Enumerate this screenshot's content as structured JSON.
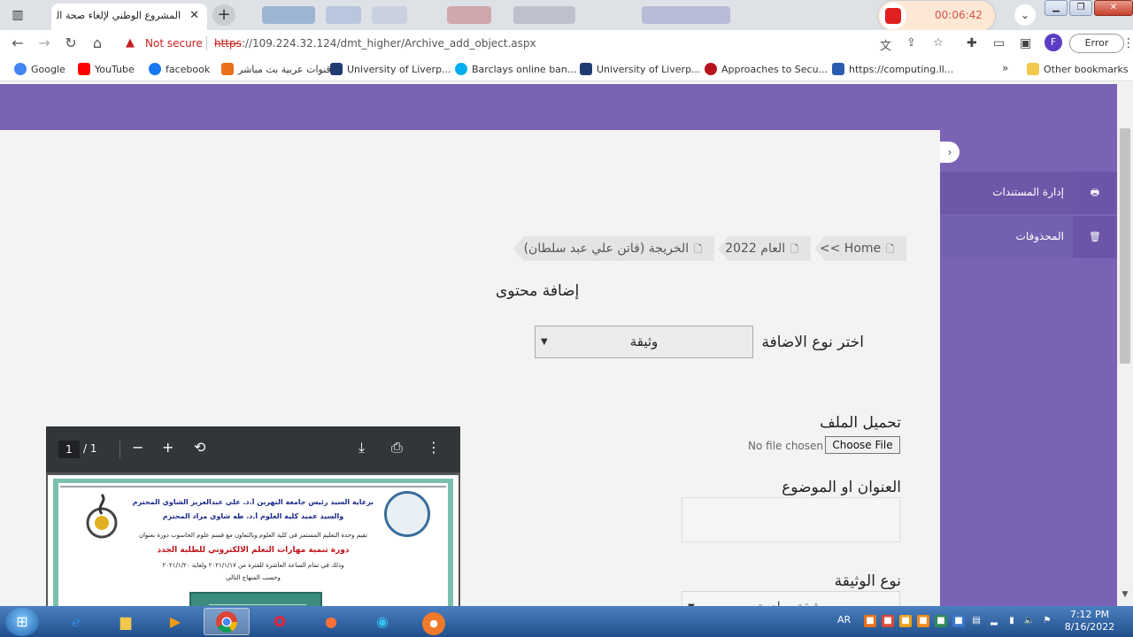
{
  "browser": {
    "tab_title": "المشروع الوطني لإلغاء صحة الصدور",
    "new_tab_label": "+",
    "recording_time": "00:06:42",
    "not_secure": "Not secure",
    "url_scheme": "https",
    "url_rest": "://109.224.32.124/dmt_higher/Archive_add_object.aspx",
    "profile_initial": "F",
    "error_label": "Error",
    "bookmarks": [
      {
        "label": "Google",
        "color": "#4285f4"
      },
      {
        "label": "YouTube",
        "color": "#ff0000"
      },
      {
        "label": "facebook",
        "color": "#1877f2"
      },
      {
        "label": "قنوات عربية بث مباشر",
        "color": "#e8711a"
      },
      {
        "label": "University of Liverp...",
        "color": "#1f3b70"
      },
      {
        "label": "Barclays online ban...",
        "color": "#00aeef"
      },
      {
        "label": "University of Liverp...",
        "color": "#1f3b70"
      },
      {
        "label": "Approaches to Secu...",
        "color": "#b5121b"
      },
      {
        "label": "https://computing.ll...",
        "color": "#2a5db0"
      }
    ],
    "other_bookmarks": "Other bookmarks"
  },
  "sidebar": {
    "items": [
      {
        "label": "إدارة المستندات",
        "icon": "print-icon"
      },
      {
        "label": "المحذوفات",
        "icon": "trash-icon"
      }
    ]
  },
  "breadcrumbs": [
    {
      "label": "Home >>"
    },
    {
      "label": "العام 2022"
    },
    {
      "label": "الخريجة (فاتن علي عبد سلطان)"
    }
  ],
  "form": {
    "title": "إضافة محتوى",
    "add_type_label": "اختر نوع الاضافة",
    "add_type_value": "وثيقة",
    "upload_label": "تحميل الملف",
    "no_file": "No file chosen",
    "choose_file": "Choose File",
    "subject_label": "العنوان او الموضوع",
    "doc_type_label": "نوع الوثيقة",
    "doc_type_value": "وثيقة صادرة"
  },
  "pdf": {
    "current_page": "1",
    "total_pages": "/ 1",
    "lines": [
      "برعاية السيد رئيس جامعة النهرين أ.د. علي عبدالعزيز الشاوي المحترم",
      "والسيد عميد كلية العلوم أ.د. طه شاوي مراد المحترم",
      "تقيم وحدة التعليم المستمر في كلية العلوم وبالتعاون مع قسم علوم الحاسوب دورة بعنوان",
      "دورة تنمية مهارات التعلم الالكتروني للطلبة الجدد",
      "وذلك في تمام الساعة العاشرة للفترة من ٢٠٢١/١/١٧ ولغاية ٢٠٢١/١/٢٠",
      "وحسب المنهاج التالي"
    ]
  },
  "taskbar": {
    "lang": "AR",
    "time": "7:12 PM",
    "date": "8/16/2022"
  }
}
